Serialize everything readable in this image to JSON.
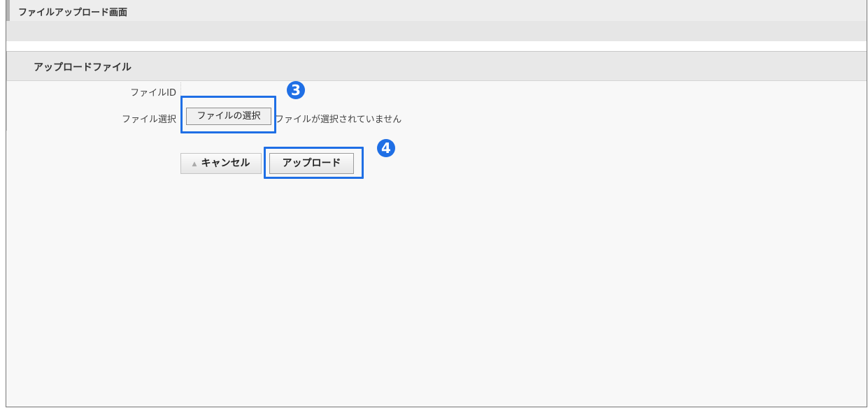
{
  "page": {
    "title": "ファイルアップロード画面"
  },
  "section": {
    "title": "アップロードファイル"
  },
  "form": {
    "file_id_label": "ファイルID",
    "file_select_label": "ファイル選択",
    "choose_file_button": "ファイルの選択",
    "no_file_text": "ファイルが選択されていません"
  },
  "actions": {
    "cancel_label": "キャンセル",
    "cancel_icon": "caret-up-icon",
    "upload_label": "アップロード"
  },
  "annotations": {
    "marker_3": "3",
    "marker_4": "4",
    "color": "#1f6fe5"
  }
}
